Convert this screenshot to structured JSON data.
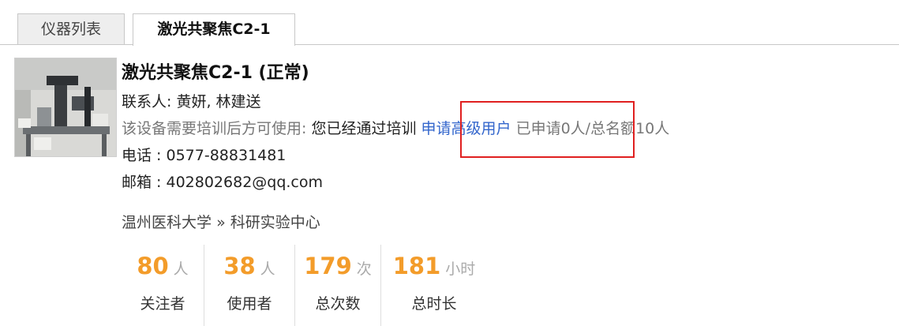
{
  "tabs": [
    {
      "label": "仪器列表",
      "active": false
    },
    {
      "label": "激光共聚焦C2-1",
      "active": true
    }
  ],
  "instrument": {
    "image_alt": "instrument-photo",
    "title": "激光共聚焦C2-1 (正常)",
    "contacts": "联系人: 黄妍, 林建送",
    "training_prefix": "该设备需要培训后方可使用:",
    "training_status": "您已经通过培训",
    "apply_link": "申请高级用户",
    "quota": "已申请0人/总名额10人",
    "phone": "电话 : 0577-88831481",
    "email": "邮箱 : 402802682@qq.com",
    "breadcrumb": {
      "org": "温州医科大学",
      "sep": "»",
      "dept": "科研实验中心"
    }
  },
  "stats": [
    {
      "value": "80",
      "unit": "人",
      "label": "关注者"
    },
    {
      "value": "38",
      "unit": "人",
      "label": "使用者"
    },
    {
      "value": "179",
      "unit": "次",
      "label": "总次数"
    },
    {
      "value": "181",
      "unit": "小时",
      "label": "总时长"
    }
  ],
  "colors": {
    "accent_number": "#f39c2a",
    "link": "#3366cc",
    "highlight_box": "#e02020"
  }
}
